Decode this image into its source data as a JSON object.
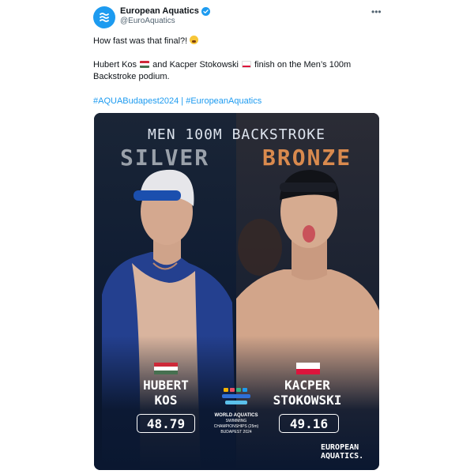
{
  "author": {
    "name": "European Aquatics",
    "handle": "@EuroAquatics"
  },
  "tweet": {
    "line1": "How fast was that final?!",
    "line2_part1": "Hubert Kos",
    "line2_part2": "and Kacper Stokowski",
    "line2_part3": "finish on the Men’s 100m Backstroke podium.",
    "hashtags": "#AQUABudapest2024 | #EuropeanAquatics"
  },
  "graphic": {
    "title": "MEN 100M BACKSTROKE",
    "medal_left": "SILVER",
    "medal_right": "BRONZE",
    "athlete_left": {
      "first": "HUBERT",
      "last": "KOS",
      "time": "48.79",
      "flag": "hungary"
    },
    "athlete_right": {
      "first": "KACPER",
      "last": "STOKOWSKI",
      "time": "49.16",
      "flag": "poland"
    },
    "event_logo": {
      "line1": "WORLD AQUATICS",
      "line2": "SWIMMING",
      "line3": "CHAMPIONSHIPS (25m)",
      "line4": "BUDAPEST 2024"
    },
    "brand_line1": "EUROPEAN",
    "brand_line2": "AQUATICS."
  },
  "icons": {
    "avatar": "european-aquatics-logo",
    "verified": "verified-badge-icon",
    "more": "more-options-icon",
    "emoji": "astonished-face-emoji"
  },
  "colors": {
    "link": "#1d9bf0",
    "silver": "#9aa1aa",
    "bronze": "#d98a4e",
    "hungary": [
      "#ce2939",
      "#ffffff",
      "#477050"
    ],
    "poland": [
      "#ffffff",
      "#dc143c"
    ]
  }
}
